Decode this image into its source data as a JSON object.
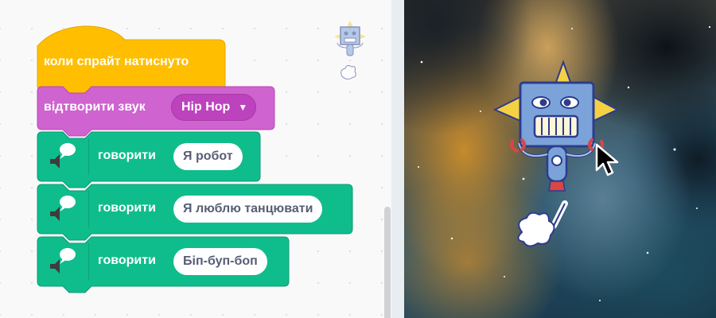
{
  "workspace": {
    "hat_block": {
      "label": "коли спрайт натиснуто",
      "color": "#ffbf00"
    },
    "sound_block": {
      "label": "відтворити звук",
      "sound_menu": {
        "selected": "Hip Hop",
        "icon": "chevron-down-icon"
      },
      "color": "#cf63cf"
    },
    "say_blocks": [
      {
        "label": "говорити",
        "value": "Я робот",
        "icon": "speech-bubble-icon"
      },
      {
        "label": "говорити",
        "value": "Я люблю танцювати",
        "icon": "speech-bubble-icon"
      },
      {
        "label": "говорити",
        "value": "Біп-буп-боп",
        "icon": "speech-bubble-icon"
      }
    ],
    "say_color": "#0fbd8c",
    "sprite_thumbnail": "robot-sprite-icon"
  },
  "stage": {
    "backdrop": "nebula-backdrop",
    "sprite": "robot-sprite",
    "cursor": "mouse-pointer-icon"
  }
}
